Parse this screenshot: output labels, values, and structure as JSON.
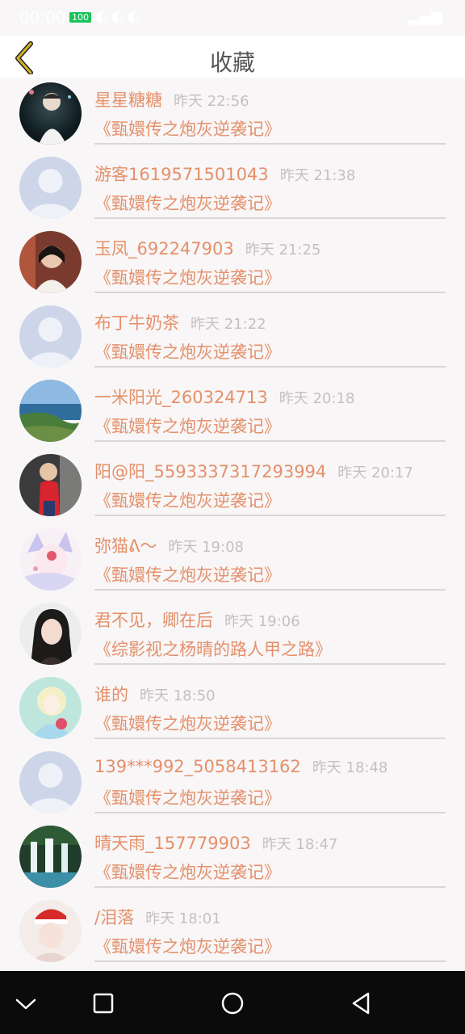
{
  "status_bar": {
    "time": "00:00",
    "battery": "100"
  },
  "header": {
    "title": "收藏"
  },
  "items": [
    {
      "name": "星星糖糖",
      "time": "昨天 22:56",
      "book": "《甄嬛传之炮灰逆袭记》",
      "avatar": "photo-boy"
    },
    {
      "name": "游客1619571501043",
      "time": "昨天 21:38",
      "book": "《甄嬛传之炮灰逆袭记》",
      "avatar": "default"
    },
    {
      "name": "玉凤_692247903",
      "time": "昨天 21:25",
      "book": "《甄嬛传之炮灰逆袭记》",
      "avatar": "photo-woman"
    },
    {
      "name": "布丁牛奶茶",
      "time": "昨天 21:22",
      "book": "《甄嬛传之炮灰逆袭记》",
      "avatar": "default"
    },
    {
      "name": "一米阳光_260324713",
      "time": "昨天 20:18",
      "book": "《甄嬛传之炮灰逆袭记》",
      "avatar": "photo-sea"
    },
    {
      "name": "阳@阳_5593337317293994",
      "time": "昨天 20:17",
      "book": "《甄嬛传之炮灰逆袭记》",
      "avatar": "photo-child"
    },
    {
      "name": "弥猫ᕕ〜",
      "time": "昨天 19:08",
      "book": "《甄嬛传之炮灰逆袭记》",
      "avatar": "anime-cat"
    },
    {
      "name": "君不见，卿在后",
      "time": "昨天 19:06",
      "book": "《综影视之杨晴的路人甲之路》",
      "avatar": "photo-girl"
    },
    {
      "name": "谁的",
      "time": "昨天 18:50",
      "book": "《甄嬛传之炮灰逆袭记》",
      "avatar": "anime-girl"
    },
    {
      "name": "139***992_5058413162",
      "time": "昨天 18:48",
      "book": "《甄嬛传之炮灰逆袭记》",
      "avatar": "default"
    },
    {
      "name": "晴天雨_157779903",
      "time": "昨天 18:47",
      "book": "《甄嬛传之炮灰逆袭记》",
      "avatar": "photo-waterfall"
    },
    {
      "name": "/泪落",
      "time": "昨天 18:01",
      "book": "《甄嬛传之炮灰逆袭记》",
      "avatar": "photo-santa"
    }
  ],
  "colors": {
    "accent": "#e5906a",
    "time_gray": "#c4c0c2",
    "back_arrow": "#d5b12a",
    "nav_bar": "#0b0b0b"
  }
}
